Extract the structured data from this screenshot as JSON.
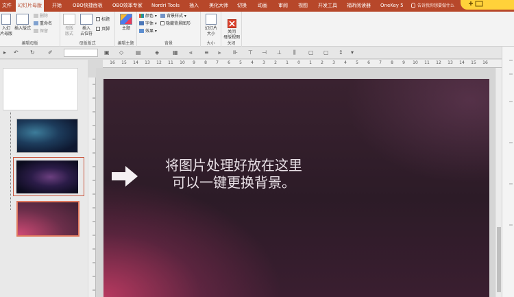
{
  "tabs": [
    {
      "label": "文件"
    },
    {
      "label": "幻灯片母版"
    },
    {
      "label": "开始"
    },
    {
      "label": "OBO快捷面板"
    },
    {
      "label": "OBO效率专家"
    },
    {
      "label": "Nordri Tools"
    },
    {
      "label": "插入"
    },
    {
      "label": "美化大师"
    },
    {
      "label": "切换"
    },
    {
      "label": "动画"
    },
    {
      "label": "审阅"
    },
    {
      "label": "视图"
    },
    {
      "label": "开发工具"
    },
    {
      "label": "福昕阅读器"
    },
    {
      "label": "OneKey 5"
    }
  ],
  "tell_me": "告诉我你想要做什么",
  "ribbon": {
    "edit_master": {
      "insert_slide_master": "入幻\n片母版",
      "insert_layout": "插入版式",
      "delete": "删除",
      "rename": "重命名",
      "preserve": "保留",
      "label": "编辑母版"
    },
    "master_layout": {
      "master_layout": "母版\n版式",
      "insert_placeholder": "插入\n占位符",
      "title": "标题",
      "footer": "页脚",
      "label": "母版版式"
    },
    "edit_theme": {
      "themes": "主题",
      "label": "编辑主题"
    },
    "background": {
      "colors": "颜色",
      "fonts": "字体",
      "effects": "效果",
      "background_styles": "背景样式",
      "hide_background": "隐藏背景图形",
      "label": "背景"
    },
    "size": {
      "slide_size": "幻灯片\n大小",
      "label": "大小"
    },
    "close": {
      "close_master": "关闭\n母版视图",
      "label": "关闭"
    }
  },
  "ruler_ticks": [
    "16",
    "15",
    "14",
    "13",
    "12",
    "11",
    "10",
    "9",
    "8",
    "7",
    "6",
    "5",
    "4",
    "3",
    "2",
    "1",
    "0",
    "1",
    "2",
    "3",
    "4",
    "5",
    "6",
    "7",
    "8",
    "9",
    "10",
    "11",
    "12",
    "13",
    "14",
    "15",
    "16"
  ],
  "slide": {
    "line1": "将图片处理好放在这里",
    "line2": "可以一键更换背景。"
  },
  "colors": {
    "accent": "#b7472a",
    "slide_dark": "#2c1b27",
    "slide_pink": "#cd3e68"
  }
}
